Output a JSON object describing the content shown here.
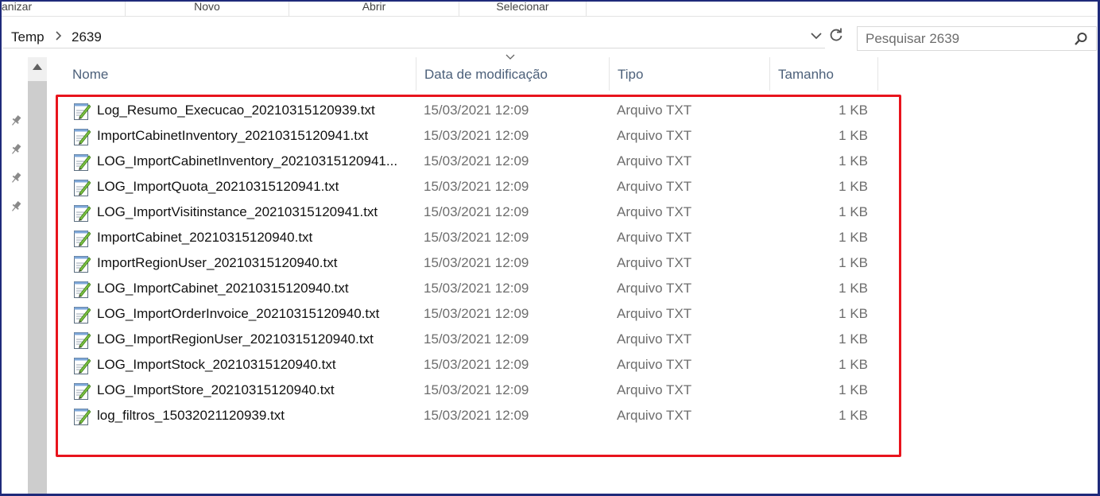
{
  "ribbon": {
    "groups": [
      "anizar",
      "Novo",
      "Abrir",
      "Selecionar"
    ]
  },
  "address": {
    "crumbs": [
      "Temp",
      "2639"
    ],
    "separator_icon": "chevron-right-icon",
    "dropdown_icon": "chevron-down-icon",
    "refresh_icon": "refresh-icon"
  },
  "search": {
    "placeholder": "Pesquisar 2639",
    "value": "",
    "icon": "search-icon"
  },
  "nav": {
    "pins": [
      "pin-icon",
      "pin-icon",
      "pin-icon",
      "pin-icon"
    ]
  },
  "columns": {
    "name": "Nome",
    "date": "Data de modificação",
    "type": "Tipo",
    "size": "Tamanho"
  },
  "files": [
    {
      "name": "Log_Resumo_Execucao_20210315120939.txt",
      "date": "15/03/2021 12:09",
      "type": "Arquivo TXT",
      "size": "1 KB"
    },
    {
      "name": "ImportCabinetInventory_20210315120941.txt",
      "date": "15/03/2021 12:09",
      "type": "Arquivo TXT",
      "size": "1 KB"
    },
    {
      "name": "LOG_ImportCabinetInventory_20210315120941...",
      "date": "15/03/2021 12:09",
      "type": "Arquivo TXT",
      "size": "1 KB"
    },
    {
      "name": "LOG_ImportQuota_20210315120941.txt",
      "date": "15/03/2021 12:09",
      "type": "Arquivo TXT",
      "size": "1 KB"
    },
    {
      "name": "LOG_ImportVisitinstance_20210315120941.txt",
      "date": "15/03/2021 12:09",
      "type": "Arquivo TXT",
      "size": "1 KB"
    },
    {
      "name": "ImportCabinet_20210315120940.txt",
      "date": "15/03/2021 12:09",
      "type": "Arquivo TXT",
      "size": "1 KB"
    },
    {
      "name": "ImportRegionUser_20210315120940.txt",
      "date": "15/03/2021 12:09",
      "type": "Arquivo TXT",
      "size": "1 KB"
    },
    {
      "name": "LOG_ImportCabinet_20210315120940.txt",
      "date": "15/03/2021 12:09",
      "type": "Arquivo TXT",
      "size": "1 KB"
    },
    {
      "name": "LOG_ImportOrderInvoice_20210315120940.txt",
      "date": "15/03/2021 12:09",
      "type": "Arquivo TXT",
      "size": "1 KB"
    },
    {
      "name": "LOG_ImportRegionUser_20210315120940.txt",
      "date": "15/03/2021 12:09",
      "type": "Arquivo TXT",
      "size": "1 KB"
    },
    {
      "name": "LOG_ImportStock_20210315120940.txt",
      "date": "15/03/2021 12:09",
      "type": "Arquivo TXT",
      "size": "1 KB"
    },
    {
      "name": "LOG_ImportStore_20210315120940.txt",
      "date": "15/03/2021 12:09",
      "type": "Arquivo TXT",
      "size": "1 KB"
    },
    {
      "name": "log_filtros_15032021120939.txt",
      "date": "15/03/2021 12:09",
      "type": "Arquivo TXT",
      "size": "1 KB"
    }
  ],
  "colors": {
    "highlight": "#e8141d",
    "header_text": "#4c607a",
    "secondary_text": "#6d6d6d"
  }
}
